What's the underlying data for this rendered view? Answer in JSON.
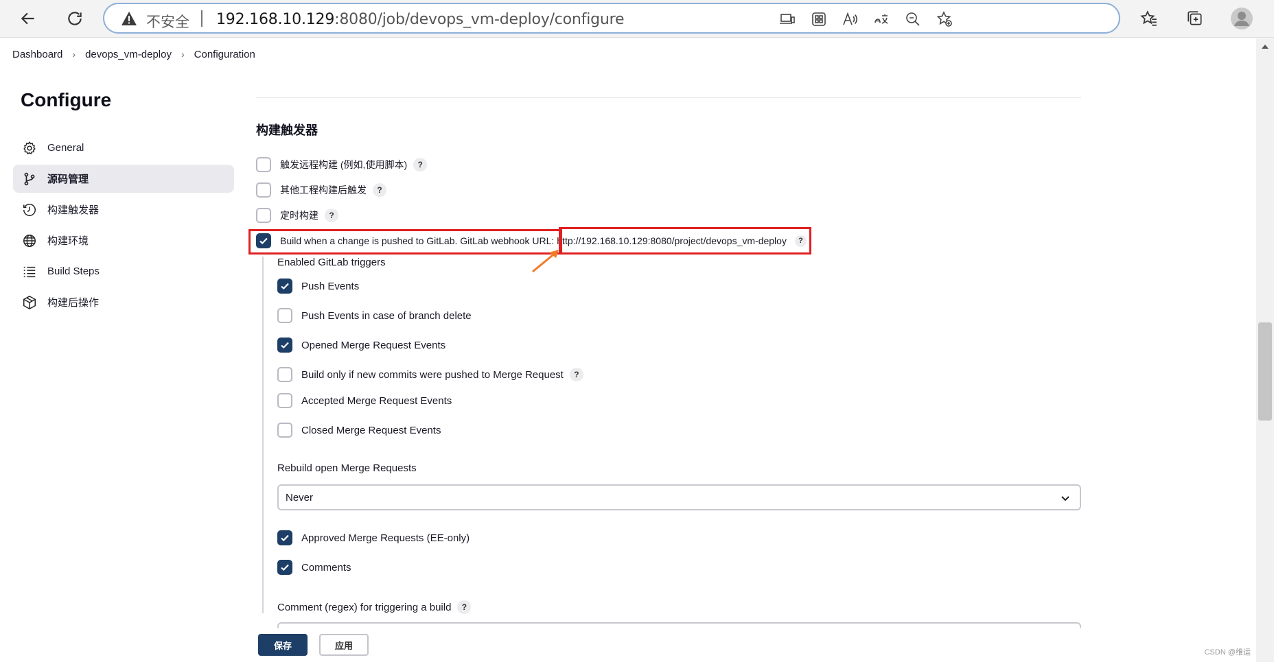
{
  "browser": {
    "insecure_label": "不安全",
    "url_host": "192.168.10.129",
    "url_rest": ":8080/job/devops_vm-deploy/configure"
  },
  "breadcrumb": [
    "Dashboard",
    "devops_vm-deploy",
    "Configuration"
  ],
  "sidebar": {
    "title": "Configure",
    "items": [
      {
        "label": "General",
        "icon": "gear-icon"
      },
      {
        "label": "源码管理",
        "icon": "branch-icon"
      },
      {
        "label": "构建触发器",
        "icon": "clock-icon"
      },
      {
        "label": "构建环境",
        "icon": "globe-icon"
      },
      {
        "label": "Build Steps",
        "icon": "list-icon"
      },
      {
        "label": "构建后操作",
        "icon": "cube-icon"
      }
    ]
  },
  "triggers": {
    "section_title": "构建触发器",
    "options": [
      {
        "label": "触发远程构建 (例如,使用脚本)",
        "checked": false
      },
      {
        "label": "其他工程构建后触发",
        "checked": false
      },
      {
        "label": "定时构建",
        "checked": false
      },
      {
        "label": "Build when a change is pushed to GitLab. GitLab webhook URL:",
        "checked": true
      }
    ],
    "webhook_url": "http://192.168.10.129:8080/project/devops_vm-deploy",
    "enabled_triggers_label": "Enabled GitLab triggers",
    "gitlab_events": [
      {
        "label": "Push Events",
        "checked": true
      },
      {
        "label": "Push Events in case of branch delete",
        "checked": false
      },
      {
        "label": "Opened Merge Request Events",
        "checked": true
      },
      {
        "label": "Build only if new commits were pushed to Merge Request",
        "checked": false
      },
      {
        "label": "Accepted Merge Request Events",
        "checked": false
      },
      {
        "label": "Closed Merge Request Events",
        "checked": false
      }
    ],
    "rebuild_label": "Rebuild open Merge Requests",
    "rebuild_value": "Never",
    "extra_events": [
      {
        "label": "Approved Merge Requests (EE-only)",
        "checked": true
      },
      {
        "label": "Comments",
        "checked": true
      }
    ],
    "comment_regex_label": "Comment (regex) for triggering a build"
  },
  "actions": {
    "save": "保存",
    "apply": "应用"
  },
  "watermark": "CSDN @维运",
  "colors": {
    "accent": "#1d3e66",
    "highlight": "#e02020",
    "arrow": "#f07c28"
  }
}
